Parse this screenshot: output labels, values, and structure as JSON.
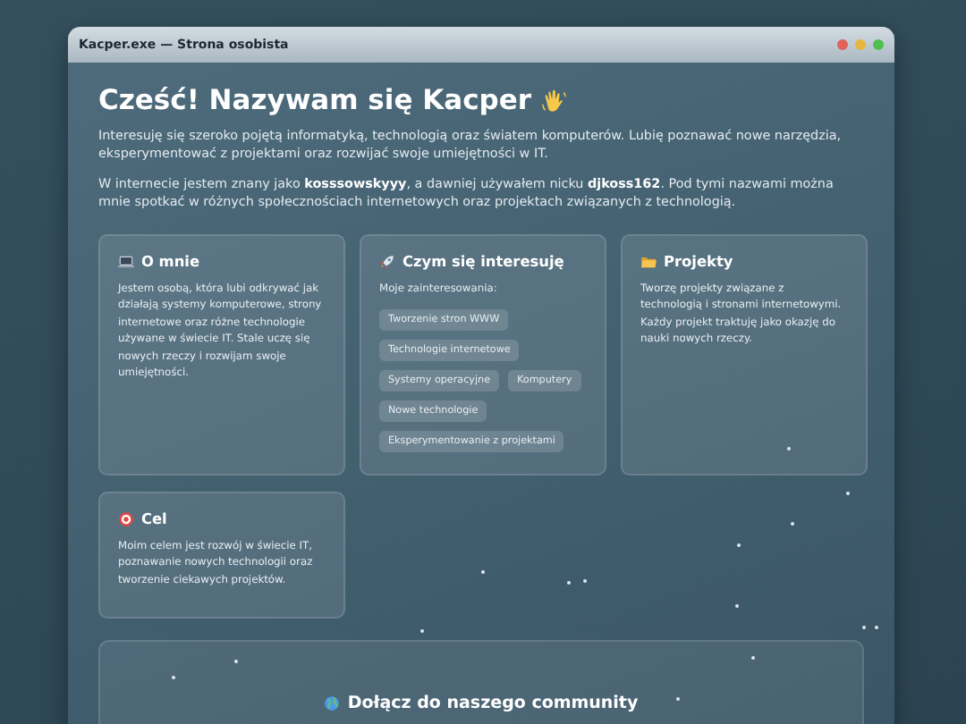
{
  "window": {
    "title": "Kacper.exe — Strona osobista"
  },
  "heading": "Cześć! Nazywam się Kacper",
  "intro": [
    "Interesuję się szeroko pojętą informatyką, technologią oraz światem komputerów. Lubię poznawać nowe narzędzia, eksperymentować z projektami oraz rozwijać swoje umiejętności w IT.",
    "W internecie jestem znany jako **kosssowskyyy**, a dawniej używałem nicku **djkoss162**. Pod tymi nazwami można mnie spotkać w różnych społecznościach internetowych oraz projektach związanych z technologią."
  ],
  "cards": [
    {
      "title": "O mnie",
      "text": "Jestem osobą, która lubi odkrywać jak działają systemy komputerowe, strony internetowe oraz różne technologie używane w świecie IT. Stale uczę się nowych rzeczy i rozwijam swoje umiejętności."
    },
    {
      "title": "Czym się interesuję",
      "text": "Moje zainteresowania:",
      "tags": [
        "Tworzenie stron WWW",
        "Technologie internetowe",
        "Systemy operacyjne",
        "Komputery",
        "Nowe technologie",
        "Eksperymentowanie z projektami"
      ]
    },
    {
      "title": "Projekty",
      "text": "Tworzę projekty związane z technologią i stronami internetowymi. Każdy projekt traktuję jako okazję do nauki nowych rzeczy."
    },
    {
      "title": "Cel",
      "text": "Moim celem jest rozwój w świecie IT, poznawanie nowych technologii oraz tworzenie ciekawych projektów."
    }
  ],
  "community": {
    "title": "Dołącz do naszego community"
  }
}
